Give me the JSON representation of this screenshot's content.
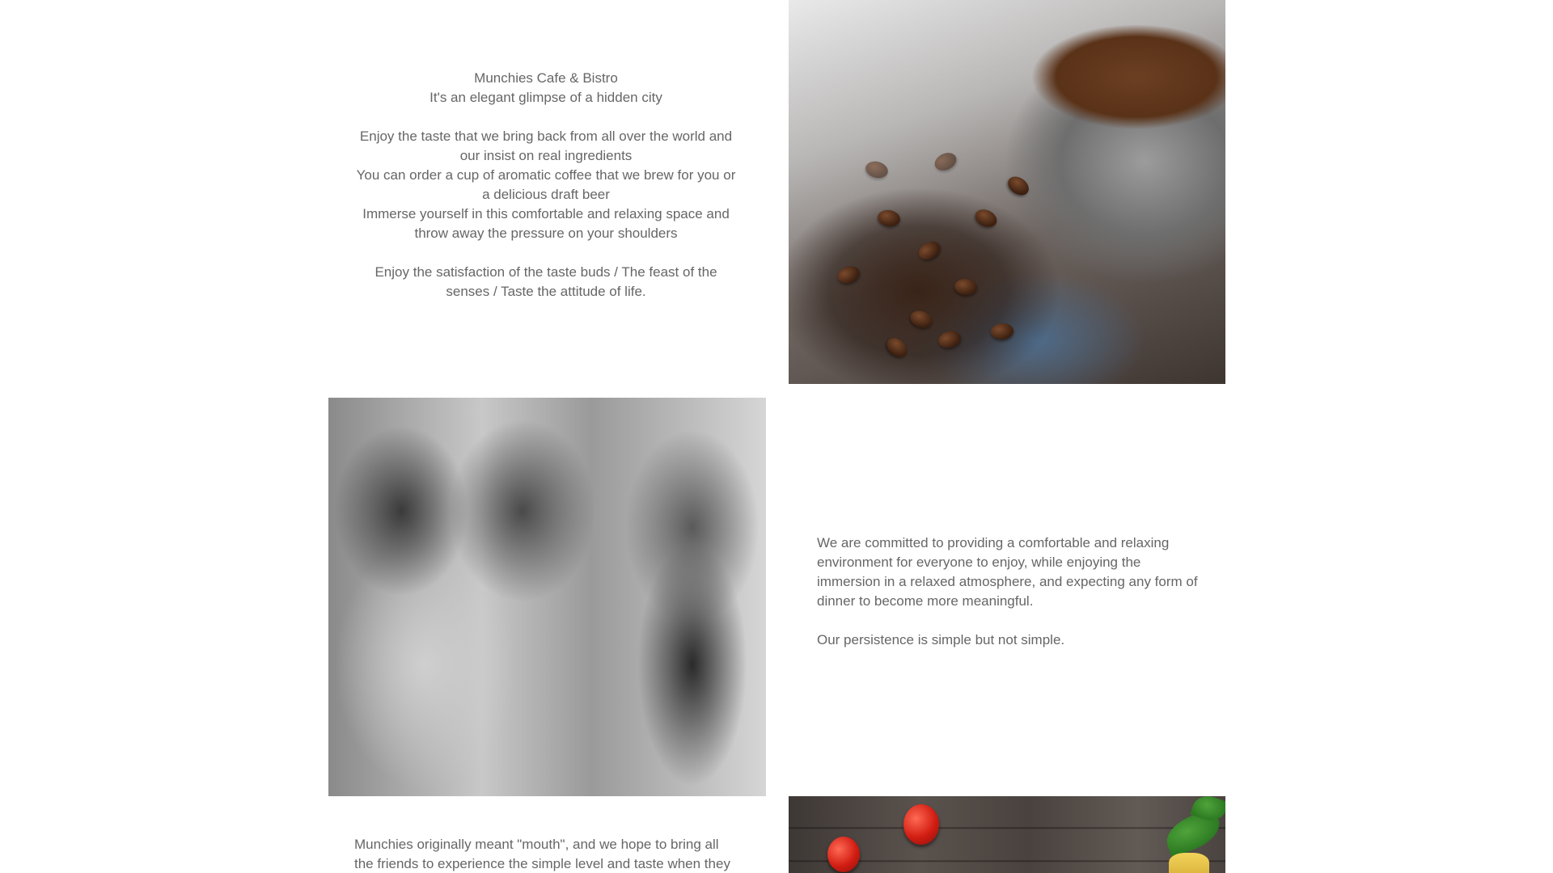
{
  "intro": {
    "title": "Munchies Cafe & Bistro",
    "tagline": "It's an elegant glimpse of a hidden city",
    "lines": [
      "Enjoy the taste that we bring back from all over the world and our insist on real ingredients",
      "You can order a cup of aromatic coffee that we brew for you or a delicious draft beer",
      "Immerse yourself in this comfortable and relaxing space and throw away the pressure on your shoulders"
    ],
    "closing": "Enjoy the satisfaction of the taste buds / The feast of the senses / Taste the attitude of life."
  },
  "commitment": {
    "paragraph": "We are committed to providing a comfortable and relaxing environment for everyone to enjoy, while enjoying the immersion in a relaxed atmosphere, and expecting any form of dinner to become more meaningful.",
    "persistence": "Our persistence is simple but not simple."
  },
  "origin": {
    "paragraph": "Munchies originally meant \"mouth\", and we hope to bring all the friends to experience the simple level and taste when they enjoy"
  },
  "images": {
    "coffee": "coffee-portafilter-photo",
    "kitchen": "kitchen-staff-photo",
    "ingredients": "ingredients-table-photo"
  },
  "colors": {
    "text": "#666666",
    "background": "#ffffff"
  }
}
